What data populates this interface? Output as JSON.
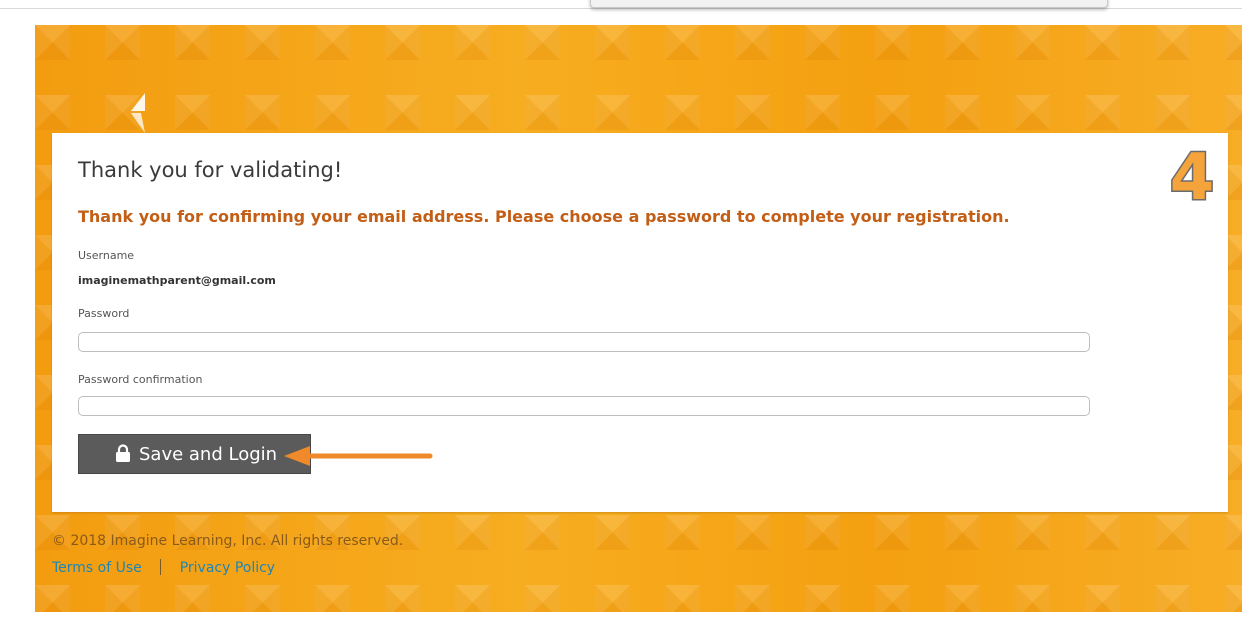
{
  "card": {
    "heading": "Thank you for validating!",
    "notice": "Thank you for confirming your email address. Please choose a password to complete your registration.",
    "step_number": "4"
  },
  "form": {
    "username_label": "Username",
    "username_value": "imaginemathparent@gmail.com",
    "password_label": "Password",
    "password_value": "",
    "password_confirmation_label": "Password confirmation",
    "password_confirmation_value": "",
    "save_button_label": "Save and Login",
    "save_button_icon": "lock-icon"
  },
  "footer": {
    "copyright": "© 2018 Imagine Learning, Inc. All rights reserved.",
    "links": [
      "Terms of Use",
      "Privacy Policy"
    ]
  },
  "colors": {
    "banner": "#f6a312",
    "notice_text": "#c25e16",
    "button": "#5b5b5b",
    "link": "#1f86b5",
    "annotation_arrow": "#ee8a2a"
  }
}
